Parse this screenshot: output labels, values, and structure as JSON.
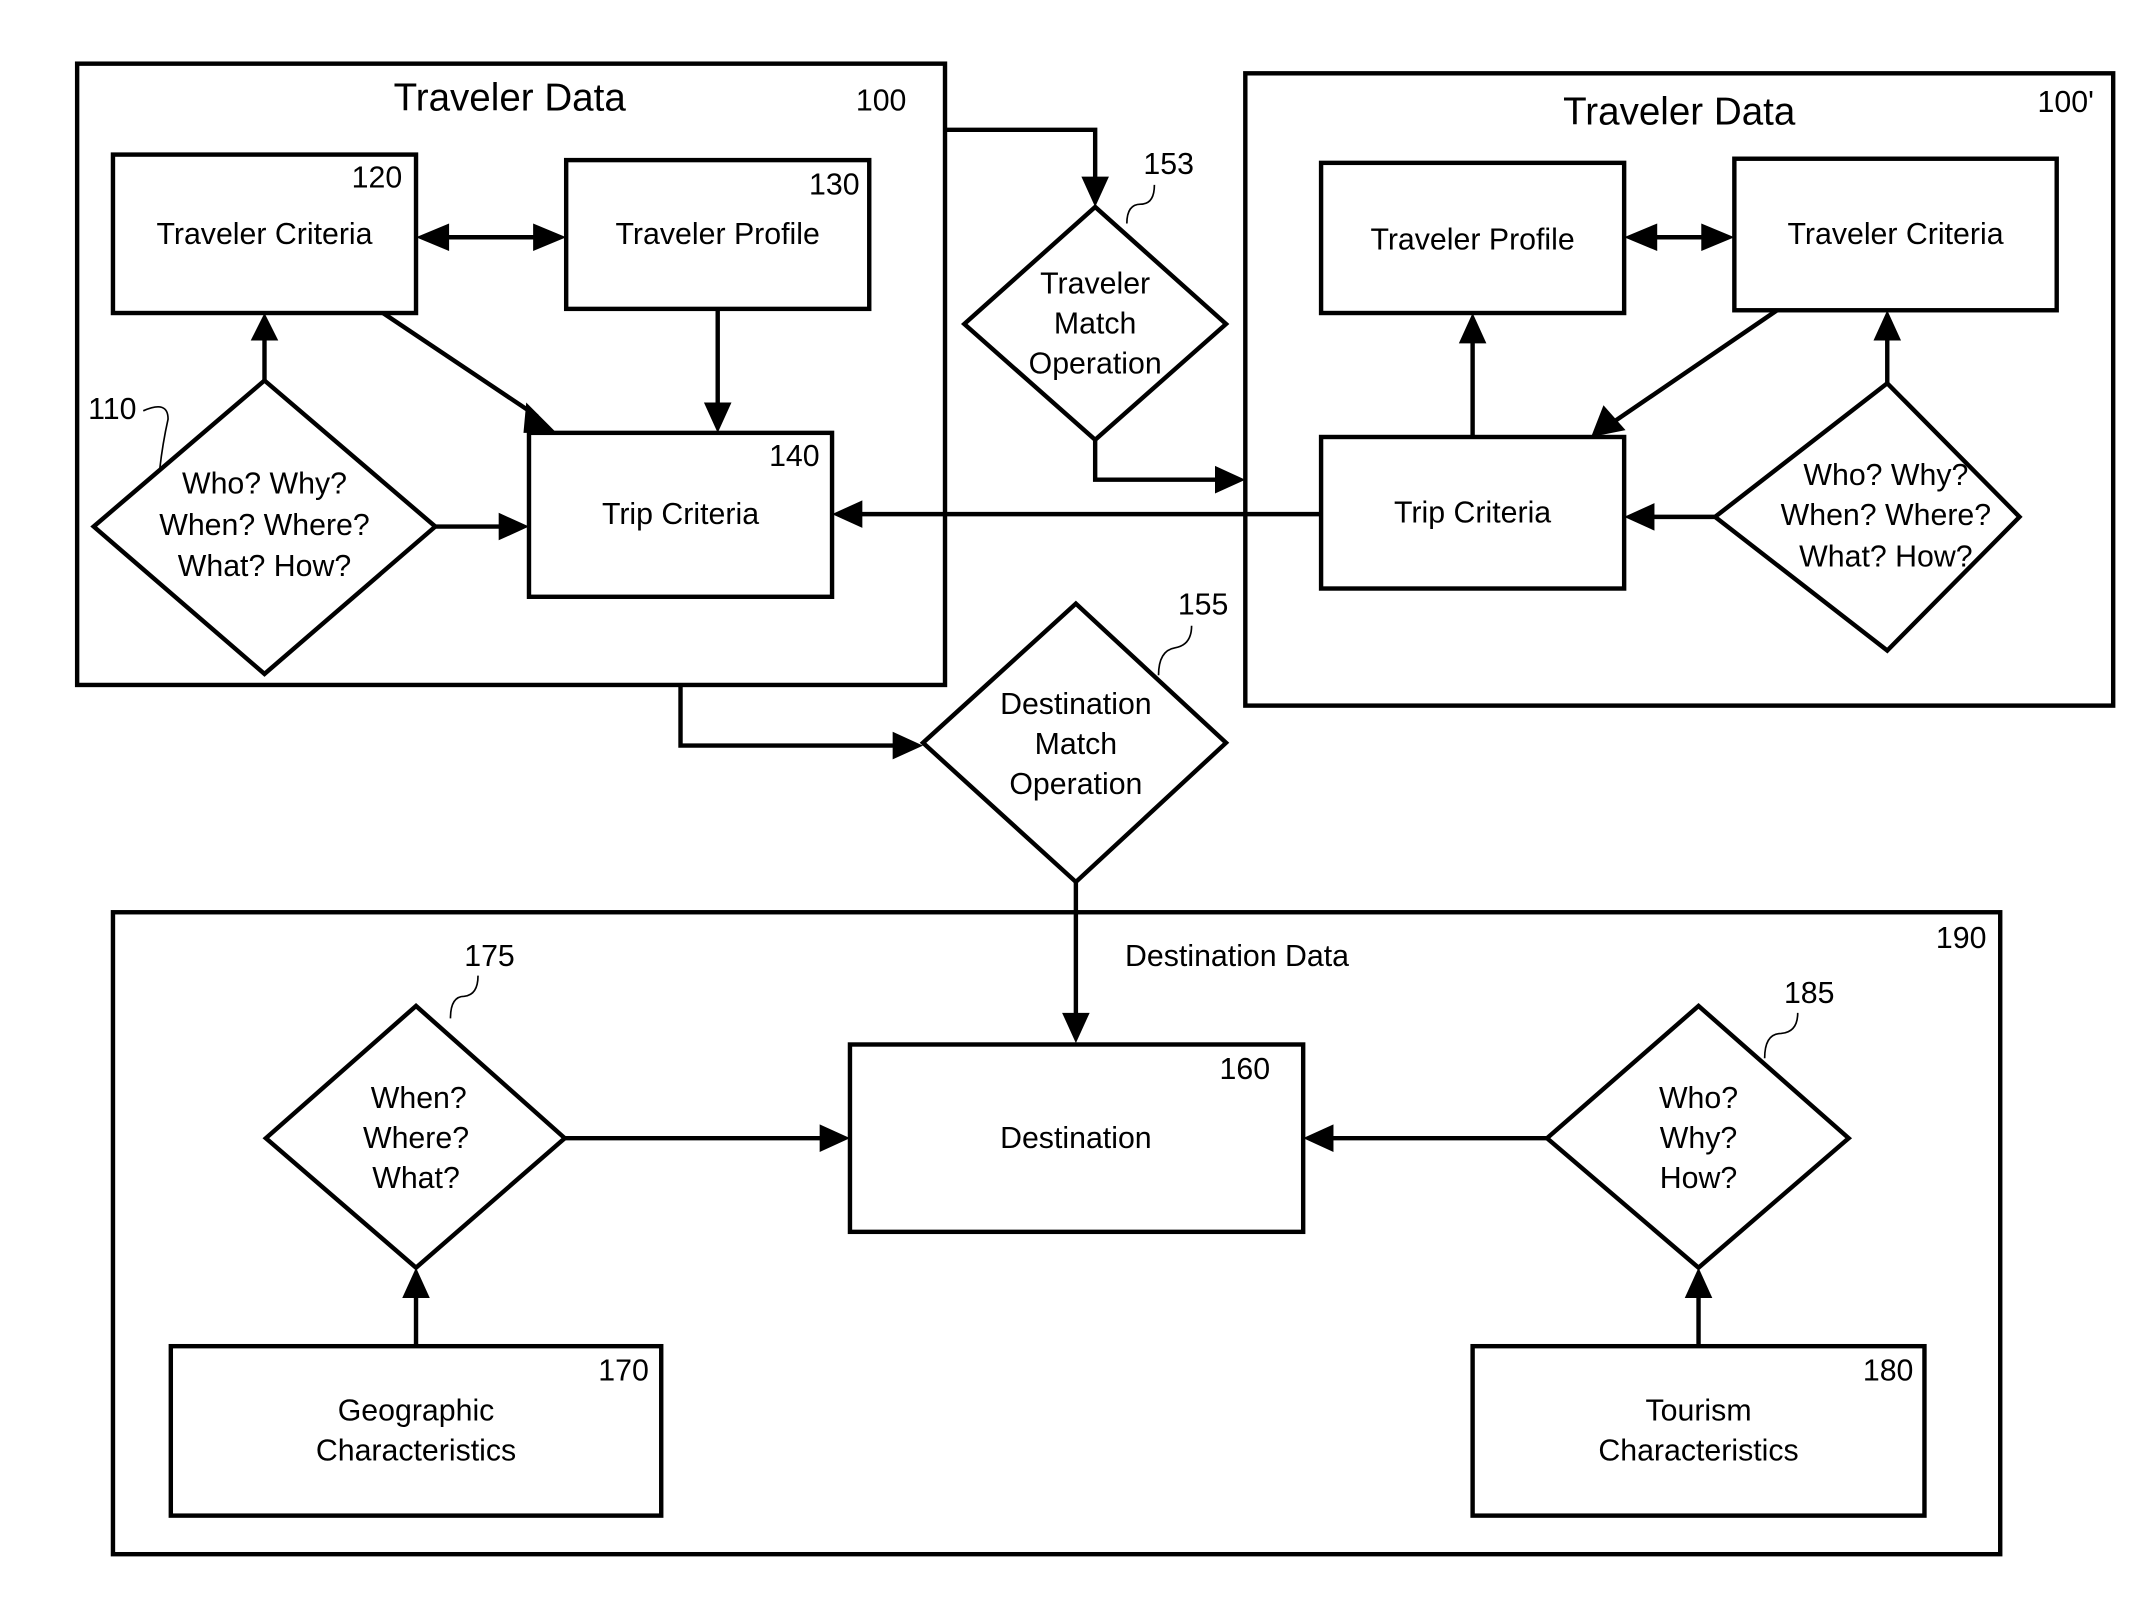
{
  "diagram": {
    "traveler_data_a": {
      "title": "Traveler Data",
      "ref": "100",
      "traveler_criteria": {
        "label": "Traveler Criteria",
        "ref": "120"
      },
      "traveler_profile": {
        "label": "Traveler Profile",
        "ref": "130"
      },
      "trip_criteria": {
        "label": "Trip Criteria",
        "ref": "140"
      },
      "questions": {
        "ref": "110",
        "lines": [
          "Who? Why?",
          "When? Where?",
          "What? How?"
        ]
      }
    },
    "traveler_data_b": {
      "title": "Traveler Data",
      "ref": "100'",
      "traveler_profile": {
        "label": "Traveler Profile"
      },
      "traveler_criteria": {
        "label": "Traveler Criteria"
      },
      "trip_criteria": {
        "label": "Trip Criteria"
      },
      "questions": {
        "lines": [
          "Who? Why?",
          "When? Where?",
          "What? How?"
        ]
      }
    },
    "traveler_match": {
      "ref": "153",
      "lines": [
        "Traveler",
        "Match",
        "Operation"
      ]
    },
    "destination_match": {
      "ref": "155",
      "lines": [
        "Destination",
        "Match",
        "Operation"
      ]
    },
    "destination_data": {
      "title": "Destination Data",
      "ref": "190",
      "destination": {
        "label": "Destination",
        "ref": "160"
      },
      "geo_questions": {
        "ref": "175",
        "lines": [
          "When?",
          "Where?",
          "What?"
        ]
      },
      "tourism_questions": {
        "ref": "185",
        "lines": [
          "Who?",
          "Why?",
          "How?"
        ]
      },
      "geographic": {
        "ref": "170",
        "lines": [
          "Geographic",
          "Characteristics"
        ]
      },
      "tourism": {
        "ref": "180",
        "lines": [
          "Tourism",
          "Characteristics"
        ]
      }
    }
  }
}
